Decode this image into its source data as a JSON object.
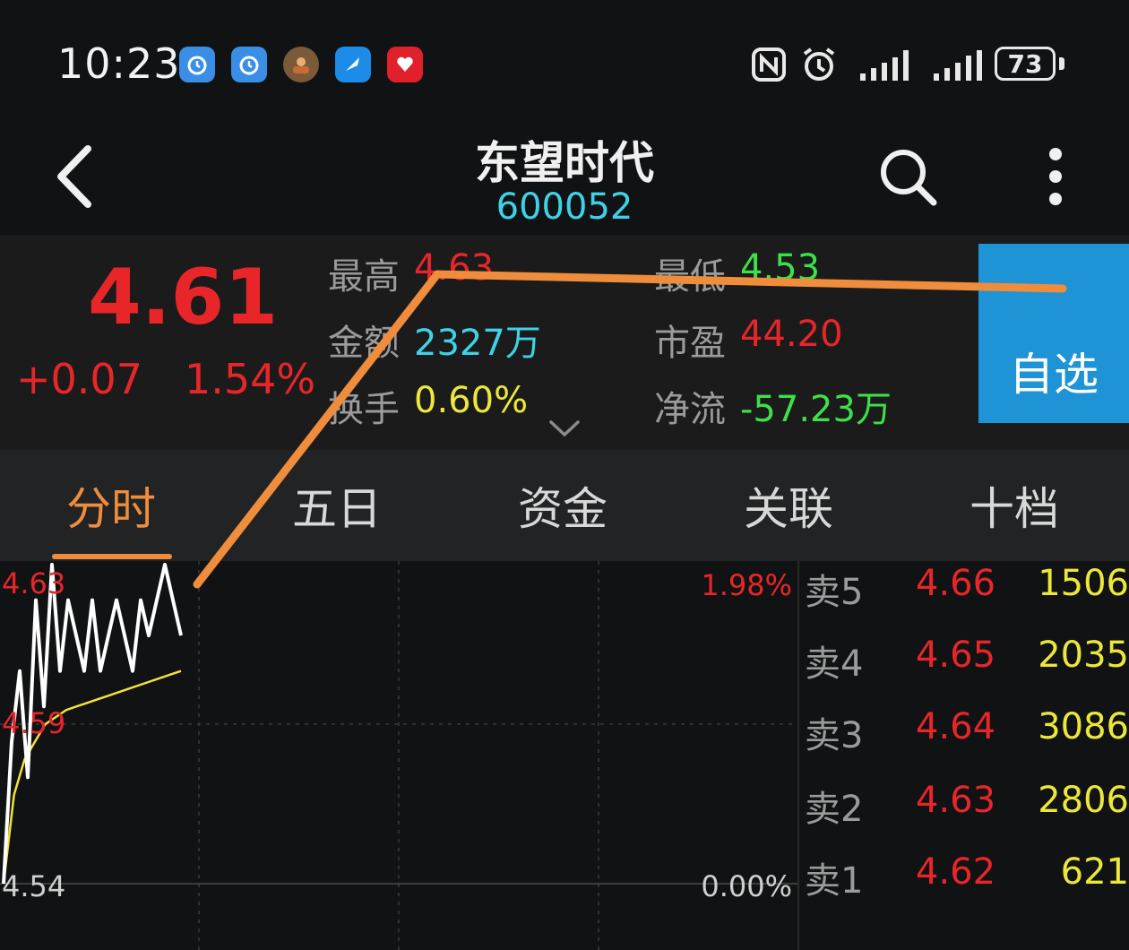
{
  "status_bar": {
    "time": "10:23",
    "battery": "73",
    "notification_icons": [
      "clock-app-icon",
      "clock-app-icon",
      "photo-app-icon",
      "feather-app-icon",
      "shop-app-icon"
    ],
    "system_icons": [
      "nfc-icon",
      "alarm-icon",
      "signal-1-icon",
      "signal-2-icon"
    ]
  },
  "header": {
    "stock_name": "东望时代",
    "stock_code": "600052"
  },
  "quote": {
    "price": "4.61",
    "change": "+0.07",
    "change_pct": "1.54%",
    "high_label": "最高",
    "high_value": "4.63",
    "low_label": "最低",
    "low_value": "4.53",
    "amount_label": "金额",
    "amount_value": "2327万",
    "pe_label": "市盈",
    "pe_value": "44.20",
    "turnover_label": "换手",
    "turnover_value": "0.60%",
    "netflow_label": "净流",
    "netflow_value": "-57.23万",
    "watchlist_label": "自选"
  },
  "tabs": [
    {
      "label": "分时",
      "active": true
    },
    {
      "label": "五日",
      "active": false
    },
    {
      "label": "资金",
      "active": false
    },
    {
      "label": "关联",
      "active": false
    },
    {
      "label": "十档",
      "active": false
    }
  ],
  "chart": {
    "y_top_label": "4.63",
    "y_mid_label": "4.59",
    "y_bottom_label": "4.54",
    "pct_top_label": "1.98%",
    "pct_bottom_label": "0.00%"
  },
  "chart_data": {
    "type": "line",
    "title": "",
    "xlabel": "",
    "ylabel": "",
    "ylim": [
      4.54,
      4.63
    ],
    "series": [
      {
        "values": [
          4.54,
          4.58,
          4.6,
          4.57,
          4.62,
          4.59,
          4.63,
          4.6,
          4.62,
          4.61,
          4.6,
          4.62,
          4.6,
          4.61,
          4.62,
          4.61,
          4.6,
          4.62,
          4.61,
          4.62,
          4.63,
          4.62,
          4.61
        ]
      },
      {
        "values": [
          4.54,
          4.565,
          4.575,
          4.58,
          4.585,
          4.587,
          4.589,
          4.59,
          4.591,
          4.592,
          4.593,
          4.594,
          4.595,
          4.596,
          4.597,
          4.598,
          4.599,
          4.6
        ]
      }
    ],
    "colors": {
      "price_line": "#ffffff",
      "avg_line": "#f2e23a",
      "annotation": "#ef8d3c"
    }
  },
  "order_book": {
    "sells": [
      {
        "label": "卖5",
        "price": "4.66",
        "volume": "1506"
      },
      {
        "label": "卖4",
        "price": "4.65",
        "volume": "2035"
      },
      {
        "label": "卖3",
        "price": "4.64",
        "volume": "3086"
      },
      {
        "label": "卖2",
        "price": "4.63",
        "volume": "2806"
      },
      {
        "label": "卖1",
        "price": "4.62",
        "volume": "621"
      }
    ]
  },
  "colors": {
    "up_red": "#e8262a",
    "down_green": "#3ee04a",
    "cyan": "#3fd2e6",
    "yellow": "#ece83a",
    "accent_orange": "#ef8d3c",
    "watch_blue": "#1e93d6"
  }
}
